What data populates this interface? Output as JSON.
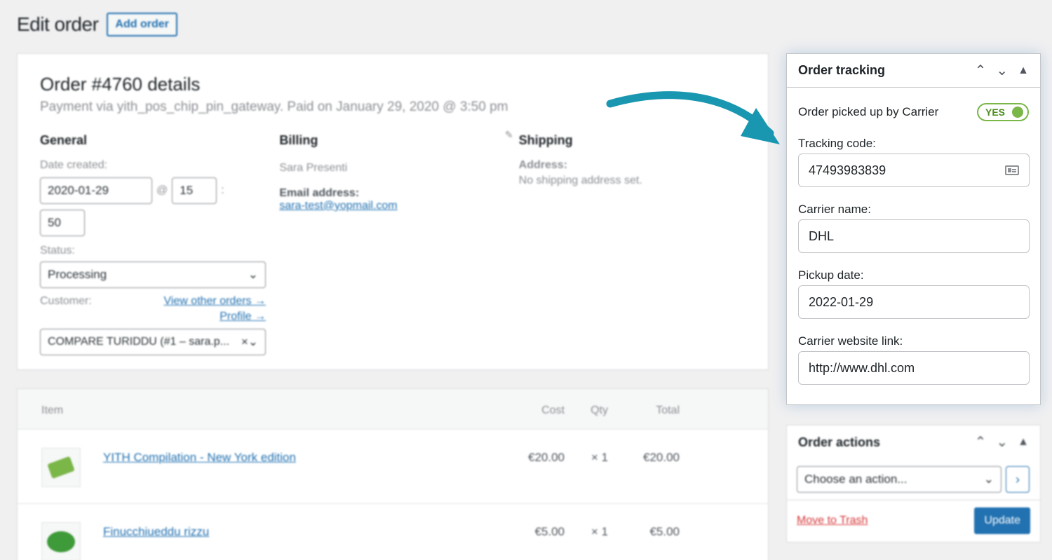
{
  "header": {
    "title": "Edit order",
    "add_order_label": "Add order"
  },
  "order": {
    "title": "Order #4760 details",
    "subtitle": "Payment via yith_pos_chip_pin_gateway. Paid on January 29, 2020 @ 3:50 pm",
    "general": {
      "heading": "General",
      "date_label": "Date created:",
      "date": "2020-01-29",
      "at": "@",
      "hour": "15",
      "colon": ":",
      "minute": "50",
      "status_label": "Status:",
      "status": "Processing",
      "customer_label": "Customer:",
      "view_orders": "View other orders →",
      "profile": "Profile →",
      "customer": "COMPARE TURIDDU (#1 – sara.p..."
    },
    "billing": {
      "heading": "Billing",
      "name": "Sara Presenti",
      "email_label": "Email address:",
      "email": "sara-test@yopmail.com"
    },
    "shipping": {
      "heading": "Shipping",
      "address_label": "Address:",
      "address": "No shipping address set."
    }
  },
  "items": {
    "headers": {
      "item": "Item",
      "cost": "Cost",
      "qty": "Qty",
      "total": "Total"
    },
    "rows": [
      {
        "name": "YITH Compilation - New York edition",
        "cost": "€20.00",
        "qty": "× 1",
        "total": "€20.00"
      },
      {
        "name": "Finucchiueddu rizzu",
        "cost": "€5.00",
        "qty": "× 1",
        "total": "€5.00"
      }
    ]
  },
  "tracking": {
    "title": "Order tracking",
    "picked_label": "Order picked up by Carrier",
    "toggle_label": "YES",
    "tracking_code_label": "Tracking code:",
    "tracking_code": "47493983839",
    "carrier_name_label": "Carrier name:",
    "carrier_name": "DHL",
    "pickup_date_label": "Pickup date:",
    "pickup_date": "2022-01-29",
    "carrier_link_label": "Carrier website link:",
    "carrier_link": "http://www.dhl.com"
  },
  "actions": {
    "title": "Order actions",
    "select_placeholder": "Choose an action...",
    "trash_label": "Move to Trash",
    "update_label": "Update"
  },
  "colors": {
    "accent": "#2271b1",
    "arrow": "#1a97b0",
    "toggle": "#7ab648",
    "danger": "#d63638"
  }
}
